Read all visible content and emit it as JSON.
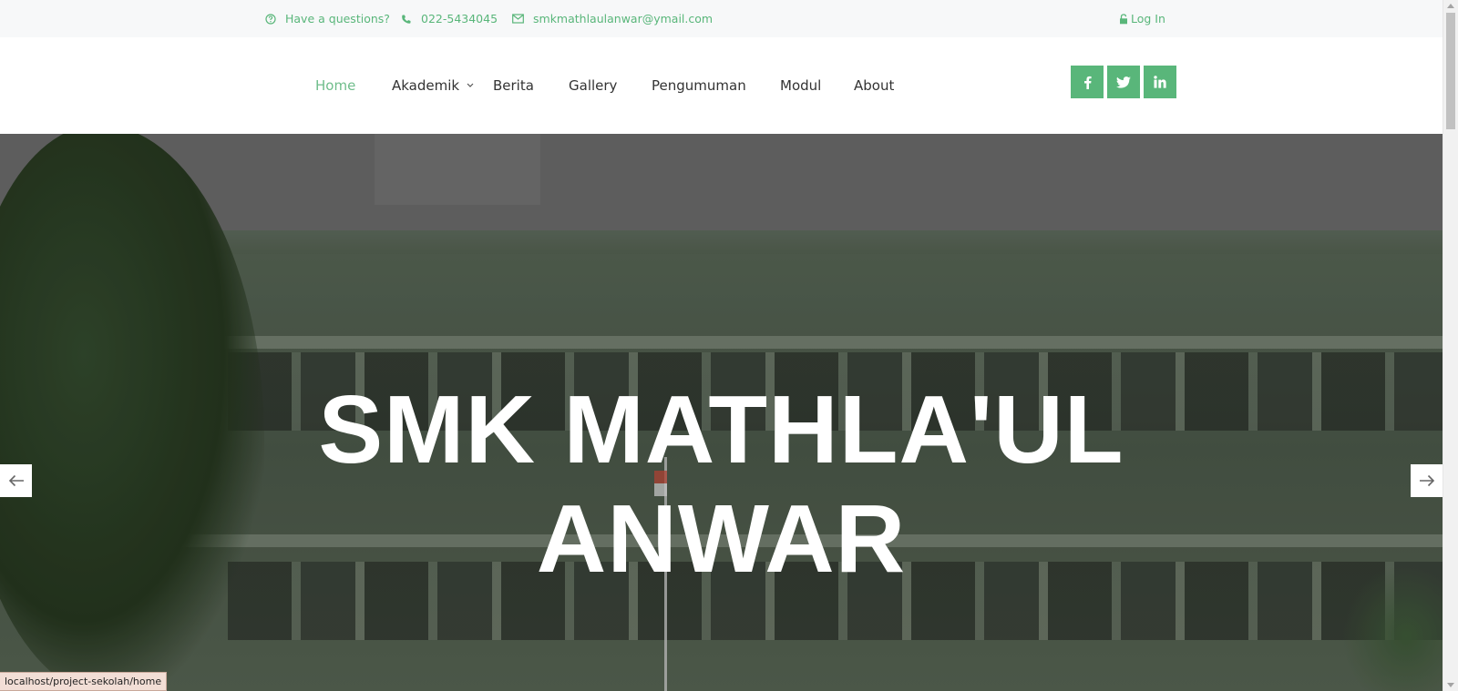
{
  "topbar": {
    "question": "Have a questions?",
    "phone": "022-5434045",
    "email": "smkmathlaulanwar@ymail.com",
    "login": "Log In",
    "icons": [
      "question-circle-icon",
      "phone-icon",
      "mail-icon",
      "lock-icon"
    ]
  },
  "nav": {
    "items": [
      {
        "label": "Home",
        "active": true
      },
      {
        "label": "Akademik",
        "has_dropdown": true
      },
      {
        "label": "Berita"
      },
      {
        "label": "Gallery"
      },
      {
        "label": "Pengumuman"
      },
      {
        "label": "Modul"
      },
      {
        "label": "About"
      }
    ]
  },
  "social": [
    "facebook-icon",
    "twitter-icon",
    "linkedin-icon"
  ],
  "hero": {
    "title_line1": "SMK MATHLA'UL",
    "title_line2": "ANWAR",
    "prev_icon": "arrow-left-icon",
    "next_icon": "arrow-right-icon"
  },
  "status_bar": {
    "url": "localhost/project-sekolah/home"
  },
  "colors": {
    "accent": "#59b67a",
    "active_nav": "#6fbd8b",
    "topbar_bg": "#f7f8f9"
  }
}
